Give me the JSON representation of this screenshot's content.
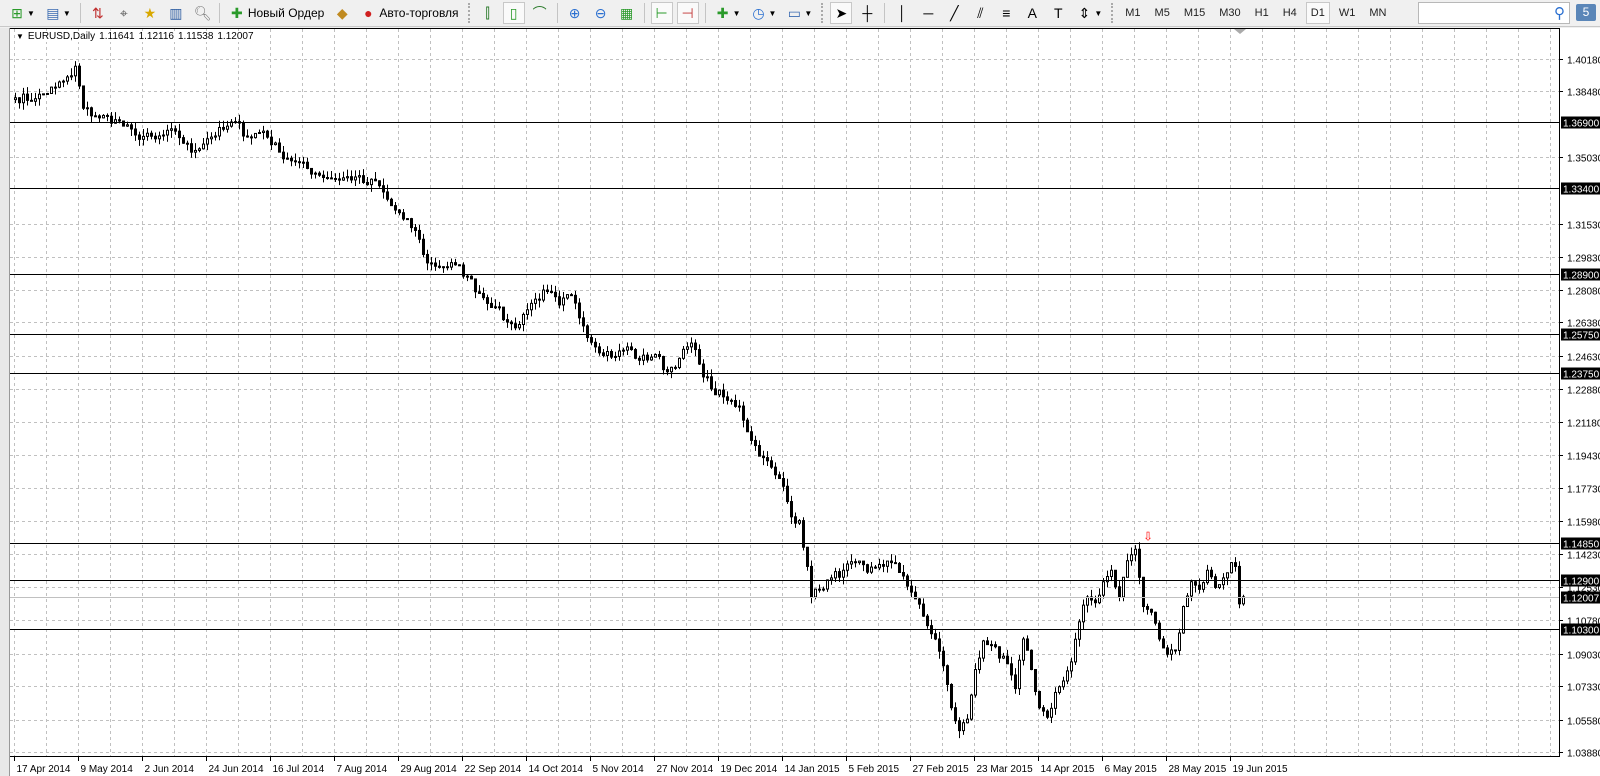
{
  "toolbar": {
    "new_order_label": "Новый Ордер",
    "autotrading_label": "Авто-торговля",
    "icons": [
      "new-chart-icon",
      "profiles-icon",
      "market-watch-icon",
      "navigator-crosshair-icon",
      "favorites-icon",
      "data-window-icon",
      "strategy-tester-icon",
      "new-order-icon",
      "metaeditor-icon",
      "autotrading-icon",
      "bar-chart-icon",
      "candlestick-icon",
      "line-chart-icon",
      "zoom-in-icon",
      "zoom-out-icon",
      "tile-windows-icon",
      "chart-shift-icon",
      "autoscroll-icon",
      "indicators-icon",
      "periods-icon",
      "templates-icon",
      "cursor-icon",
      "crosshair-icon",
      "vertical-line-icon",
      "horizontal-line-icon",
      "trendline-icon",
      "fibonacci-icon",
      "channel-icon",
      "text-icon",
      "text-label-icon",
      "arrows-icon"
    ],
    "timeframes": [
      "M1",
      "M5",
      "M15",
      "M30",
      "H1",
      "H4",
      "D1",
      "W1",
      "MN"
    ],
    "active_timeframe": "D1",
    "search_value": "",
    "notifications_count": "5"
  },
  "chart_header": {
    "symbol": "EURUSD,Daily",
    "open": "1.11641",
    "high": "1.12116",
    "low": "1.11538",
    "close": "1.12007"
  },
  "colors": {
    "bull_fill": "#ffffff",
    "bear_fill": "#000000",
    "line": "#000000",
    "grid": "#c0c0c0",
    "current_price_line": "#c0c0c0",
    "arrow": "#ff0000"
  },
  "chart_data": {
    "type": "candlestick",
    "symbol": "EURUSD",
    "timeframe": "Daily",
    "ylim": [
      1.0388,
      1.4018
    ],
    "price_ticks": [
      "1.40180",
      "1.38480",
      "1.35030",
      "1.31530",
      "1.29830",
      "1.28080",
      "1.26380",
      "1.24630",
      "1.22880",
      "1.21180",
      "1.19430",
      "1.17730",
      "1.15980",
      "1.14230",
      "1.12530",
      "1.10780",
      "1.09030",
      "1.07330",
      "1.05580",
      "1.03880"
    ],
    "date_ticks": [
      "17 Apr 2014",
      "9 May 2014",
      "2 Jun 2014",
      "24 Jun 2014",
      "16 Jul 2014",
      "7 Aug 2014",
      "29 Aug 2014",
      "22 Sep 2014",
      "14 Oct 2014",
      "5 Nov 2014",
      "27 Nov 2014",
      "19 Dec 2014",
      "14 Jan 2015",
      "5 Feb 2015",
      "27 Feb 2015",
      "23 Mar 2015",
      "14 Apr 2015",
      "6 May 2015",
      "28 May 2015",
      "19 Jun 2015"
    ],
    "bars_per_date_tick": 16,
    "horizontal_lines": [
      "1.36900",
      "1.33400",
      "1.28900",
      "1.25750",
      "1.23750",
      "1.14850",
      "1.12900",
      "1.10300"
    ],
    "current_price": "1.12007",
    "arrow_marker": {
      "bar": 283,
      "price": 1.1495,
      "symbol": "⇩"
    },
    "close_anchors_bar_price": [
      [
        0,
        1.3815
      ],
      [
        5,
        1.381
      ],
      [
        10,
        1.387
      ],
      [
        14,
        1.393
      ],
      [
        15,
        1.398
      ],
      [
        17,
        1.376
      ],
      [
        20,
        1.372
      ],
      [
        25,
        1.37
      ],
      [
        30,
        1.362
      ],
      [
        35,
        1.36
      ],
      [
        40,
        1.364
      ],
      [
        44,
        1.353
      ],
      [
        48,
        1.36
      ],
      [
        52,
        1.365
      ],
      [
        55,
        1.369
      ],
      [
        58,
        1.361
      ],
      [
        62,
        1.364
      ],
      [
        66,
        1.353
      ],
      [
        70,
        1.348
      ],
      [
        75,
        1.342
      ],
      [
        80,
        1.339
      ],
      [
        85,
        1.34
      ],
      [
        88,
        1.336
      ],
      [
        90,
        1.338
      ],
      [
        94,
        1.325
      ],
      [
        97,
        1.318
      ],
      [
        100,
        1.312
      ],
      [
        103,
        1.295
      ],
      [
        107,
        1.293
      ],
      [
        110,
        1.294
      ],
      [
        113,
        1.288
      ],
      [
        116,
        1.279
      ],
      [
        120,
        1.272
      ],
      [
        123,
        1.264
      ],
      [
        125,
        1.261
      ],
      [
        127,
        1.268
      ],
      [
        130,
        1.276
      ],
      [
        133,
        1.28
      ],
      [
        136,
        1.273
      ],
      [
        139,
        1.278
      ],
      [
        142,
        1.262
      ],
      [
        145,
        1.251
      ],
      [
        150,
        1.246
      ],
      [
        153,
        1.251
      ],
      [
        156,
        1.244
      ],
      [
        160,
        1.247
      ],
      [
        163,
        1.238
      ],
      [
        166,
        1.245
      ],
      [
        169,
        1.253
      ],
      [
        171,
        1.242
      ],
      [
        174,
        1.229
      ],
      [
        178,
        1.223
      ],
      [
        181,
        1.22
      ],
      [
        184,
        1.202
      ],
      [
        187,
        1.193
      ],
      [
        190,
        1.184
      ],
      [
        192,
        1.178
      ],
      [
        194,
        1.162
      ],
      [
        196,
        1.16
      ],
      [
        198,
        1.136
      ],
      [
        199,
        1.12
      ],
      [
        201,
        1.124
      ],
      [
        204,
        1.13
      ],
      [
        207,
        1.134
      ],
      [
        210,
        1.138
      ],
      [
        213,
        1.133
      ],
      [
        216,
        1.137
      ],
      [
        219,
        1.138
      ],
      [
        222,
        1.131
      ],
      [
        225,
        1.119
      ],
      [
        228,
        1.105
      ],
      [
        230,
        1.098
      ],
      [
        232,
        1.084
      ],
      [
        234,
        1.062
      ],
      [
        236,
        1.05
      ],
      [
        238,
        1.056
      ],
      [
        240,
        1.082
      ],
      [
        242,
        1.097
      ],
      [
        244,
        1.095
      ],
      [
        246,
        1.088
      ],
      [
        248,
        1.085
      ],
      [
        250,
        1.072
      ],
      [
        252,
        1.098
      ],
      [
        254,
        1.082
      ],
      [
        256,
        1.062
      ],
      [
        258,
        1.057
      ],
      [
        260,
        1.07
      ],
      [
        262,
        1.076
      ],
      [
        264,
        1.086
      ],
      [
        266,
        1.107
      ],
      [
        268,
        1.12
      ],
      [
        270,
        1.117
      ],
      [
        272,
        1.128
      ],
      [
        274,
        1.134
      ],
      [
        276,
        1.12
      ],
      [
        278,
        1.139
      ],
      [
        280,
        1.145
      ],
      [
        282,
        1.115
      ],
      [
        284,
        1.112
      ],
      [
        286,
        1.098
      ],
      [
        288,
        1.09
      ],
      [
        290,
        1.092
      ],
      [
        292,
        1.115
      ],
      [
        294,
        1.128
      ],
      [
        296,
        1.124
      ],
      [
        298,
        1.134
      ],
      [
        300,
        1.125
      ],
      [
        302,
        1.13
      ],
      [
        304,
        1.138
      ],
      [
        305,
        1.136
      ],
      [
        306,
        1.11641
      ],
      [
        307,
        1.12007
      ]
    ],
    "last_bar_ohlc": [
      1.11641,
      1.12116,
      1.11538,
      1.12007
    ]
  }
}
